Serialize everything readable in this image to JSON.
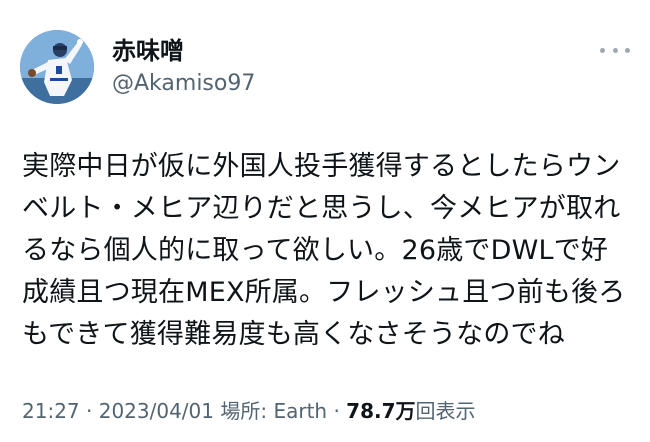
{
  "author": {
    "display_name": "赤味噌",
    "handle": "@Akamiso97"
  },
  "tweet": {
    "text": "実際中日が仮に外国人投手獲得するとしたらウンベルト・メヒア辺りだと思うし、今メヒアが取れるなら個人的に取って欲しい。26歳でDWLで好成績且つ現在MEX所属。フレッシュ且つ前も後ろもできて獲得難易度も高くなさそうなのでね"
  },
  "meta": {
    "time": "21:27",
    "sep1": " · ",
    "date": "2023/04/01",
    "location_label": " 場所: ",
    "location": "Earth",
    "sep2": " · ",
    "view_count": "78.7万",
    "view_label": "回表示"
  },
  "icons": {
    "more": "more-horizontal-icon",
    "avatar": "baseball-pitcher-avatar"
  }
}
